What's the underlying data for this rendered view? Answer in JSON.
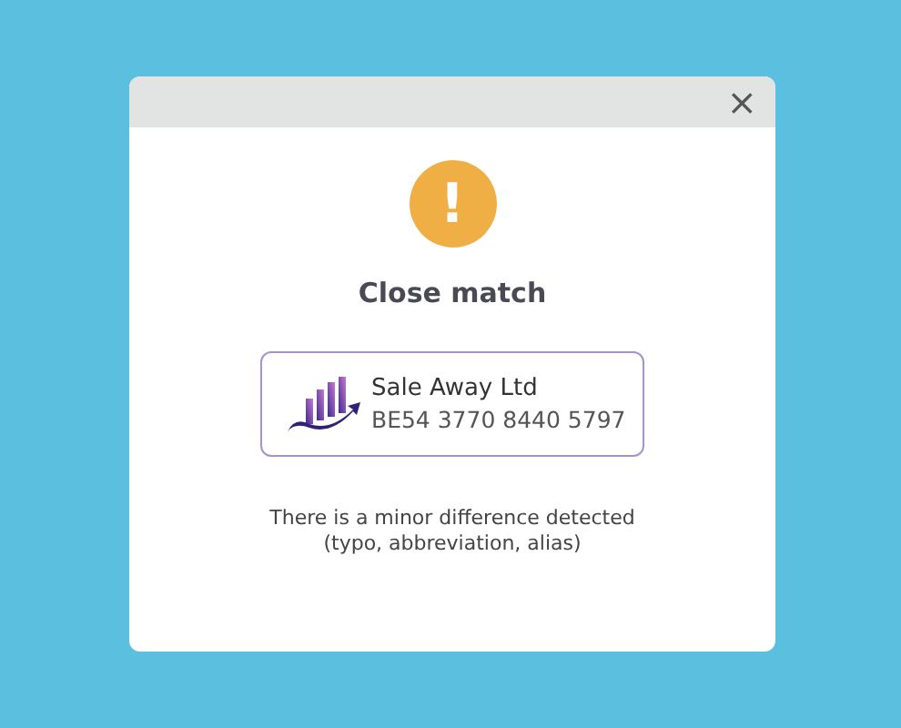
{
  "dialog": {
    "close_label": "×",
    "status_icon": {
      "kind": "warning",
      "symbol": "!"
    },
    "title": "Close match",
    "account": {
      "name": "Sale Away Ltd",
      "iban": "BE54 3770 8440 5797"
    },
    "message": [
      "There is a minor difference detected",
      "(typo, abbreviation, alias)"
    ]
  }
}
